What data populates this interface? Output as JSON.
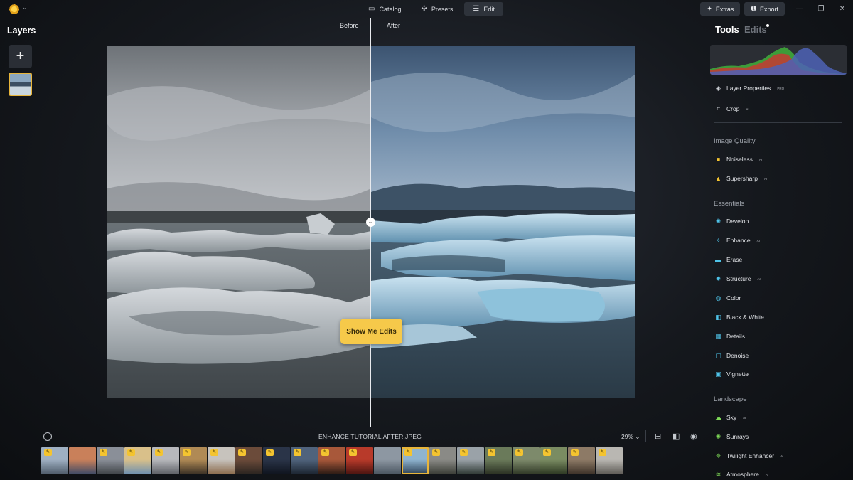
{
  "topbar": {
    "tabs": [
      {
        "label": "Catalog",
        "icon": "catalog-icon"
      },
      {
        "label": "Presets",
        "icon": "presets-icon"
      },
      {
        "label": "Edit",
        "icon": "edit-icon",
        "active": true
      }
    ],
    "extras_label": "Extras",
    "export_label": "Export"
  },
  "layers": {
    "title": "Layers"
  },
  "canvas": {
    "before_label": "Before",
    "after_label": "After",
    "show_edits_label": "Show Me Edits"
  },
  "filmstrip": {
    "file_name": "ENHANCE TUTORIAL AFTER.JPEG",
    "zoom": "29%",
    "thumbnails": [
      {
        "c1": "#9fb0c2",
        "c2": "#4e5b6a",
        "badge": true
      },
      {
        "c1": "#c9805a",
        "c2": "#3d4a66",
        "badge": false
      },
      {
        "c1": "#8a8f98",
        "c2": "#3f4347",
        "badge": true
      },
      {
        "c1": "#d9c08a",
        "c2": "#6d8fb0",
        "badge": true
      },
      {
        "c1": "#b7b8bc",
        "c2": "#5d6066",
        "badge": true
      },
      {
        "c1": "#b08a55",
        "c2": "#3a3025",
        "badge": true
      },
      {
        "c1": "#c7c3bd",
        "c2": "#8b6b4c",
        "badge": true
      },
      {
        "c1": "#6b4b3a",
        "c2": "#2a2420",
        "badge": true
      },
      {
        "c1": "#2a3448",
        "c2": "#0f141e",
        "badge": true
      },
      {
        "c1": "#50637c",
        "c2": "#1b2430",
        "badge": true
      },
      {
        "c1": "#a8583a",
        "c2": "#2a1a14",
        "badge": true
      },
      {
        "c1": "#b83a2a",
        "c2": "#4a1410",
        "badge": true
      },
      {
        "c1": "#8d97a2",
        "c2": "#4a5560",
        "badge": false
      },
      {
        "c1": "#8fb4cf",
        "c2": "#2e4256",
        "badge": true,
        "selected": true
      },
      {
        "c1": "#8a8a86",
        "c2": "#3a3d36",
        "badge": true
      },
      {
        "c1": "#9aa2a8",
        "c2": "#2f3934",
        "badge": true
      },
      {
        "c1": "#6a7a5a",
        "c2": "#2a3022",
        "badge": true
      },
      {
        "c1": "#7d8a6b",
        "c2": "#303826",
        "badge": true
      },
      {
        "c1": "#7a8c62",
        "c2": "#2d3822",
        "badge": true
      },
      {
        "c1": "#8d7a66",
        "c2": "#3c3128",
        "badge": true
      },
      {
        "c1": "#b9b7b2",
        "c2": "#5d5a55",
        "badge": true
      }
    ]
  },
  "panel": {
    "tools_tab": "Tools",
    "edits_tab": "Edits",
    "top_tools": [
      {
        "label": "Layer Properties",
        "sup": "PRO",
        "icon": "layers-icon",
        "color": "#c9ccd2"
      },
      {
        "label": "Crop",
        "sup": "AI",
        "icon": "crop-icon",
        "color": "#c9ccd2"
      }
    ],
    "image_quality_title": "Image Quality",
    "image_quality": [
      {
        "label": "Noiseless",
        "sup": "AI",
        "icon": "noiseless-icon",
        "color": "#f4c430"
      },
      {
        "label": "Supersharp",
        "sup": "AI",
        "icon": "supersharp-icon",
        "color": "#f4c430"
      }
    ],
    "essentials_title": "Essentials",
    "essentials": [
      {
        "label": "Develop",
        "sup": "",
        "icon": "develop-icon",
        "color": "#4fc3e8"
      },
      {
        "label": "Enhance",
        "sup": "AI",
        "icon": "enhance-icon",
        "color": "#4fc3e8"
      },
      {
        "label": "Erase",
        "sup": "",
        "icon": "erase-icon",
        "color": "#4fc3e8"
      },
      {
        "label": "Structure",
        "sup": "AI",
        "icon": "structure-icon",
        "color": "#4fc3e8"
      },
      {
        "label": "Color",
        "sup": "",
        "icon": "color-icon",
        "color": "#4fc3e8"
      },
      {
        "label": "Black & White",
        "sup": "",
        "icon": "black-white-icon",
        "color": "#4fc3e8"
      },
      {
        "label": "Details",
        "sup": "",
        "icon": "details-icon",
        "color": "#4fc3e8"
      },
      {
        "label": "Denoise",
        "sup": "",
        "icon": "denoise-icon",
        "color": "#4fc3e8"
      },
      {
        "label": "Vignette",
        "sup": "",
        "icon": "vignette-icon",
        "color": "#4fc3e8"
      }
    ],
    "landscape_title": "Landscape",
    "landscape": [
      {
        "label": "Sky",
        "sup": "AI",
        "icon": "sky-icon",
        "color": "#7ed957"
      },
      {
        "label": "Sunrays",
        "sup": "",
        "icon": "sunrays-icon",
        "color": "#7ed957"
      },
      {
        "label": "Twilight Enhancer",
        "sup": "AI",
        "icon": "twilight-icon",
        "color": "#7ed957"
      },
      {
        "label": "Atmosphere",
        "sup": "AI",
        "icon": "atmosphere-icon",
        "color": "#7ed957"
      }
    ]
  }
}
